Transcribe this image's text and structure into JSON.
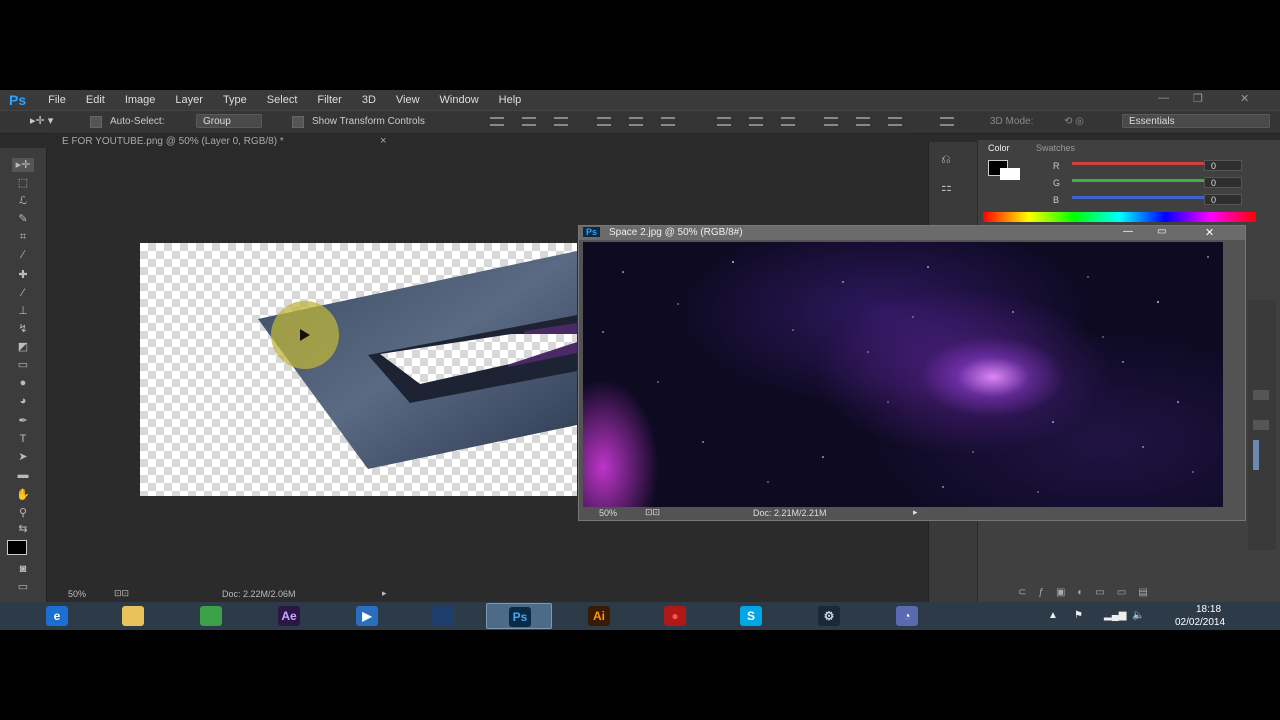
{
  "app": {
    "logo": "Ps",
    "menu": [
      "File",
      "Edit",
      "Image",
      "Layer",
      "Type",
      "Select",
      "Filter",
      "3D",
      "View",
      "Window",
      "Help"
    ]
  },
  "options": {
    "auto_select_label": "Auto-Select:",
    "group_value": "Group",
    "show_transform_label": "Show Transform Controls",
    "mode_label": "3D Mode:",
    "workspace_value": "Essentials"
  },
  "document": {
    "tab_title": "E FOR YOUTUBE.png @ 50% (Layer 0, RGB/8) *",
    "zoom": "50%",
    "doc_size": "Doc: 2.22M/2.06M"
  },
  "float_window": {
    "title": "Space 2.jpg @ 50% (RGB/8#)",
    "zoom": "50%",
    "doc_size": "Doc: 2.21M/2.21M"
  },
  "color_panel": {
    "tabs": [
      "Color",
      "Swatches"
    ],
    "channels": [
      {
        "label": "R",
        "value": "0",
        "color": "#e04040"
      },
      {
        "label": "G",
        "value": "0",
        "color": "#40c040"
      },
      {
        "label": "B",
        "value": "0",
        "color": "#4060e0"
      }
    ]
  },
  "taskbar": {
    "apps": [
      {
        "name": "internet-explorer",
        "glyph": "e",
        "bg": "#1b6fd0",
        "fg": "#ffffff"
      },
      {
        "name": "file-explorer",
        "glyph": "",
        "bg": "#e8c25a",
        "fg": "#000000"
      },
      {
        "name": "chrome",
        "glyph": "",
        "bg": "#3aa148",
        "fg": "#ffffff"
      },
      {
        "name": "after-effects",
        "glyph": "Ae",
        "bg": "#2a1745",
        "fg": "#c8a8ff"
      },
      {
        "name": "media-player",
        "glyph": "▶",
        "bg": "#2a6fbf",
        "fg": "#ffffff"
      },
      {
        "name": "cinema-4d",
        "glyph": "",
        "bg": "#1c3d6e",
        "fg": "#ffffff"
      },
      {
        "name": "photoshop",
        "glyph": "Ps",
        "bg": "#0a2a44",
        "fg": "#3fa8ff"
      },
      {
        "name": "illustrator",
        "glyph": "Ai",
        "bg": "#3a1a00",
        "fg": "#ff9a00"
      },
      {
        "name": "record",
        "glyph": "●",
        "bg": "#b01818",
        "fg": "#ff5050"
      },
      {
        "name": "skype",
        "glyph": "S",
        "bg": "#00a6e6",
        "fg": "#ffffff"
      },
      {
        "name": "steam",
        "glyph": "⚙",
        "bg": "#1b2838",
        "fg": "#c7d5e0"
      },
      {
        "name": "clock-app",
        "glyph": "◔",
        "bg": "#5a6ab0",
        "fg": "#ffffff"
      }
    ],
    "time": "18:18",
    "date": "02/02/2014"
  }
}
